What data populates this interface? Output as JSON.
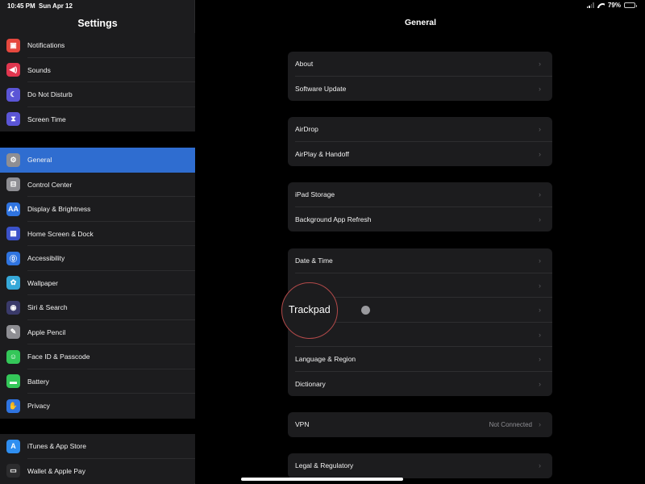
{
  "status_bar": {
    "time": "10:45 PM",
    "date": "Sun Apr 12",
    "battery": "79%",
    "battery_level": 0.79
  },
  "sidebar": {
    "title": "Settings",
    "groups": [
      [
        {
          "label": "Notifications",
          "icon": "notifications-icon",
          "color": "#e5483e",
          "glyph": "▣"
        },
        {
          "label": "Sounds",
          "icon": "sounds-icon",
          "color": "#e0364f",
          "glyph": "◀)"
        },
        {
          "label": "Do Not Disturb",
          "icon": "moon-icon",
          "color": "#5b55d6",
          "glyph": "☾"
        },
        {
          "label": "Screen Time",
          "icon": "hourglass-icon",
          "color": "#5b55d6",
          "glyph": "⧗"
        }
      ],
      [
        {
          "label": "General",
          "icon": "gear-icon",
          "color": "#8e8e93",
          "glyph": "⚙",
          "selected": true
        },
        {
          "label": "Control Center",
          "icon": "toggles-icon",
          "color": "#8e8e93",
          "glyph": "⊟"
        },
        {
          "label": "Display & Brightness",
          "icon": "display-icon",
          "color": "#2f74e0",
          "glyph": "AA"
        },
        {
          "label": "Home Screen & Dock",
          "icon": "grid-icon",
          "color": "#3b52c9",
          "glyph": "▦"
        },
        {
          "label": "Accessibility",
          "icon": "accessibility-icon",
          "color": "#2f74e0",
          "glyph": "⓪"
        },
        {
          "label": "Wallpaper",
          "icon": "flower-icon",
          "color": "#36a8d8",
          "glyph": "✿"
        },
        {
          "label": "Siri & Search",
          "icon": "siri-icon",
          "color": "#3a3a6a",
          "glyph": "◉"
        },
        {
          "label": "Apple Pencil",
          "icon": "pencil-icon",
          "color": "#8e8e93",
          "glyph": "✎"
        },
        {
          "label": "Face ID & Passcode",
          "icon": "faceid-icon",
          "color": "#34c759",
          "glyph": "☺"
        },
        {
          "label": "Battery",
          "icon": "battery-icon",
          "color": "#34c759",
          "glyph": "▬"
        },
        {
          "label": "Privacy",
          "icon": "hand-icon",
          "color": "#2f74e0",
          "glyph": "✋"
        }
      ],
      [
        {
          "label": "iTunes & App Store",
          "icon": "appstore-icon",
          "color": "#2f8ef0",
          "glyph": "A"
        },
        {
          "label": "Wallet & Apple Pay",
          "icon": "wallet-icon",
          "color": "#2c2c2e",
          "glyph": "▭"
        }
      ]
    ]
  },
  "main": {
    "title": "General",
    "groups": [
      [
        {
          "label": "About"
        },
        {
          "label": "Software Update"
        }
      ],
      [
        {
          "label": "AirDrop"
        },
        {
          "label": "AirPlay & Handoff"
        }
      ],
      [
        {
          "label": "iPad Storage"
        },
        {
          "label": "Background App Refresh"
        }
      ],
      [
        {
          "label": "Date & Time"
        },
        {
          "label": ""
        },
        {
          "label": ""
        },
        {
          "label": ""
        },
        {
          "label": "Language & Region"
        },
        {
          "label": "Dictionary"
        }
      ],
      [
        {
          "label": "VPN",
          "value": "Not Connected"
        }
      ],
      [
        {
          "label": "Legal & Regulatory"
        }
      ]
    ],
    "chevron": "›",
    "overlay_label": "Trackpad"
  }
}
